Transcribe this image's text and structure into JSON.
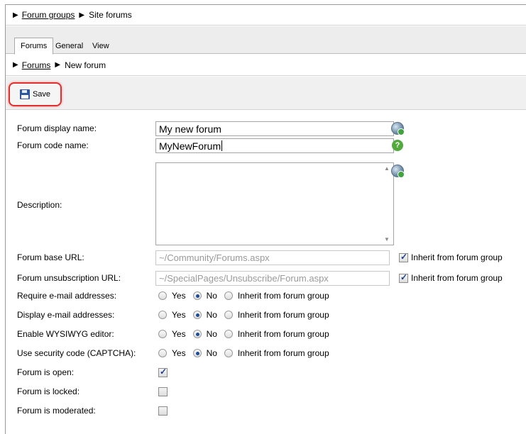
{
  "top_breadcrumb": {
    "link": "Forum groups",
    "current": "Site forums"
  },
  "tabs": [
    "Forums",
    "General",
    "View"
  ],
  "sub_breadcrumb": {
    "link": "Forums",
    "current": "New forum"
  },
  "toolbar": {
    "save_label": "Save"
  },
  "form": {
    "display_name": {
      "label": "Forum display name:",
      "value": "My new forum"
    },
    "code_name": {
      "label": "Forum code name:",
      "value": "MyNewForum"
    },
    "description": {
      "label": "Description:",
      "value": ""
    },
    "base_url": {
      "label": "Forum base URL:",
      "value": "~/Community/Forums.aspx",
      "inherit_label": "Inherit from forum group",
      "inherit": true
    },
    "unsub_url": {
      "label": "Forum unsubscription URL:",
      "value": "~/SpecialPages/Unsubscribe/Forum.aspx",
      "inherit_label": "Inherit from forum group",
      "inherit": true
    },
    "radio_options": {
      "yes": "Yes",
      "no": "No",
      "inherit": "Inherit from forum group"
    },
    "require_email": {
      "label": "Require e-mail addresses:",
      "selected": "No"
    },
    "display_email": {
      "label": "Display e-mail addresses:",
      "selected": "No"
    },
    "wysiwyg": {
      "label": "Enable WYSIWYG editor:",
      "selected": "No"
    },
    "captcha": {
      "label": "Use security code (CAPTCHA):",
      "selected": "No"
    },
    "is_open": {
      "label": "Forum is open:",
      "checked": true
    },
    "is_locked": {
      "label": "Forum is locked:",
      "checked": false
    },
    "is_moderated": {
      "label": "Forum is moderated:",
      "checked": false
    }
  },
  "colors": {
    "highlight": "#e03030",
    "link": "#000000",
    "disabled_text": "#9a9a9a"
  }
}
